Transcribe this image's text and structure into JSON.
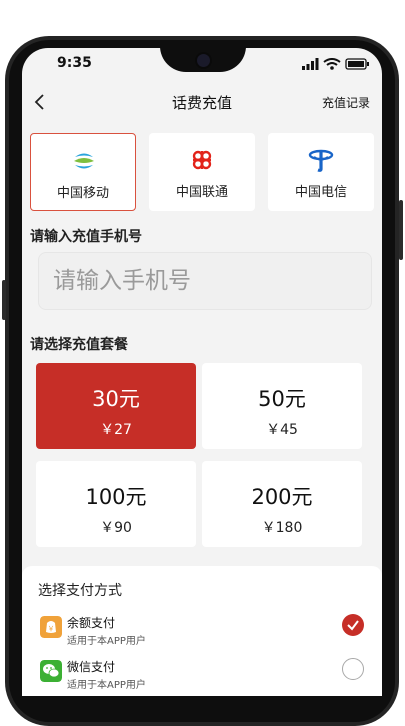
{
  "status": {
    "time": "9:35"
  },
  "header": {
    "title": "话费充值",
    "right_link": "充值记录"
  },
  "carriers": [
    {
      "label": "中国移动",
      "icon": "china-mobile-logo",
      "selected": true
    },
    {
      "label": "中国联通",
      "icon": "china-unicom-logo",
      "selected": false
    },
    {
      "label": "中国电信",
      "icon": "china-telecom-logo",
      "selected": false
    }
  ],
  "phone_section": {
    "title": "请输入充值手机号",
    "placeholder": "请输入手机号",
    "value": ""
  },
  "package_section": {
    "title": "请选择充值套餐"
  },
  "packages": [
    {
      "amount": "30元",
      "price": "￥27",
      "selected": true
    },
    {
      "amount": "50元",
      "price": "￥45",
      "selected": false
    },
    {
      "amount": "100元",
      "price": "￥90",
      "selected": false
    },
    {
      "amount": "200元",
      "price": "￥180",
      "selected": false
    }
  ],
  "payment": {
    "title": "选择支付方式",
    "methods": [
      {
        "name": "余额支付",
        "sub": "适用于本APP用户",
        "icon": "wallet-icon",
        "selected": true
      },
      {
        "name": "微信支付",
        "sub": "适用于本APP用户",
        "icon": "wechat-icon",
        "selected": false
      }
    ]
  },
  "colors": {
    "accent": "#c62e27",
    "background": "#f3f3f3",
    "wallet": "#f0a23a",
    "wechat": "#3cb034"
  }
}
